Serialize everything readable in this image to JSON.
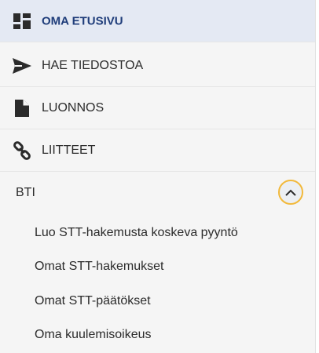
{
  "nav": {
    "items": [
      {
        "label": "OMA ETUSIVU",
        "icon": "dashboard-icon",
        "active": true
      },
      {
        "label": "HAE TIEDOSTOA",
        "icon": "send-arrow-icon",
        "active": false
      },
      {
        "label": "LUONNOS",
        "icon": "document-icon",
        "active": false
      },
      {
        "label": "LIITTEET",
        "icon": "link-icon",
        "active": false
      }
    ],
    "section": {
      "title": "BTI",
      "toggle_icon": "chevron-up-icon",
      "expanded": true,
      "items": [
        {
          "label": "Luo STT-hakemusta koskeva pyyntö"
        },
        {
          "label": "Omat STT-hakemukset"
        },
        {
          "label": "Omat STT-päätökset"
        },
        {
          "label": "Oma kuulemisoikeus"
        }
      ]
    }
  },
  "colors": {
    "active_bg": "#e4e9f3",
    "active_text": "#1f3d7a",
    "sidebar_bg": "#f5f5f5",
    "focus_ring": "#f2b93b",
    "icon": "#2b2b2b"
  }
}
